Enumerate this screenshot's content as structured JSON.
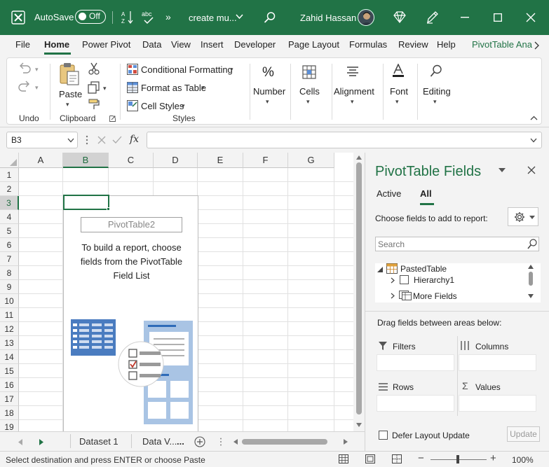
{
  "titlebar": {
    "autosave_label": "AutoSave",
    "autosave_state": "Off",
    "doc_title": "create mu...",
    "user_name": "Zahid Hassan",
    "bg_color": "#217346"
  },
  "ribbon_tabs": [
    "File",
    "Home",
    "Power Pivot",
    "Data",
    "View",
    "Insert",
    "Developer",
    "Page Layout",
    "Formulas",
    "Review",
    "Help",
    "PivotTable Ana"
  ],
  "ribbon": {
    "undo_group": "Undo",
    "paste_label": "Paste",
    "clipboard_group": "Clipboard",
    "conditional_formatting": "Conditional Formatting",
    "format_as_table": "Format as Table",
    "cell_styles": "Cell Styles",
    "styles_group": "Styles",
    "number": "Number",
    "cells": "Cells",
    "alignment": "Alignment",
    "font": "Font",
    "editing": "Editing"
  },
  "formula_bar": {
    "name_box": "B3",
    "fx_label": "fx",
    "formula_value": ""
  },
  "grid": {
    "columns": [
      "A",
      "B",
      "C",
      "D",
      "E",
      "F",
      "G"
    ],
    "rows": [
      "1",
      "2",
      "3",
      "4",
      "5",
      "6",
      "7",
      "8",
      "9",
      "10",
      "11",
      "12",
      "13",
      "14",
      "15",
      "16",
      "17",
      "18",
      "19"
    ],
    "selected_cell": "B3"
  },
  "pivot_placeholder": {
    "name": "PivotTable2",
    "message": "To build a report, choose fields from the PivotTable Field List"
  },
  "sheets": {
    "tabs": [
      "Dataset 1",
      "Data V..."
    ],
    "more": "..."
  },
  "status": {
    "message": "Select destination and press ENTER or choose Paste",
    "zoom": "100%"
  },
  "pivot_pane": {
    "title": "PivotTable Fields",
    "tab_active": "Active",
    "tab_all": "All",
    "choose_label": "Choose fields to add to report:",
    "search_placeholder": "Search",
    "table_name": "PastedTable",
    "fields": [
      "Hierarchy1",
      "More Fields"
    ],
    "drag_label": "Drag fields between areas below:",
    "filters": "Filters",
    "columns": "Columns",
    "rows": "Rows",
    "values": "Values",
    "defer_label": "Defer Layout Update",
    "update_button": "Update"
  }
}
